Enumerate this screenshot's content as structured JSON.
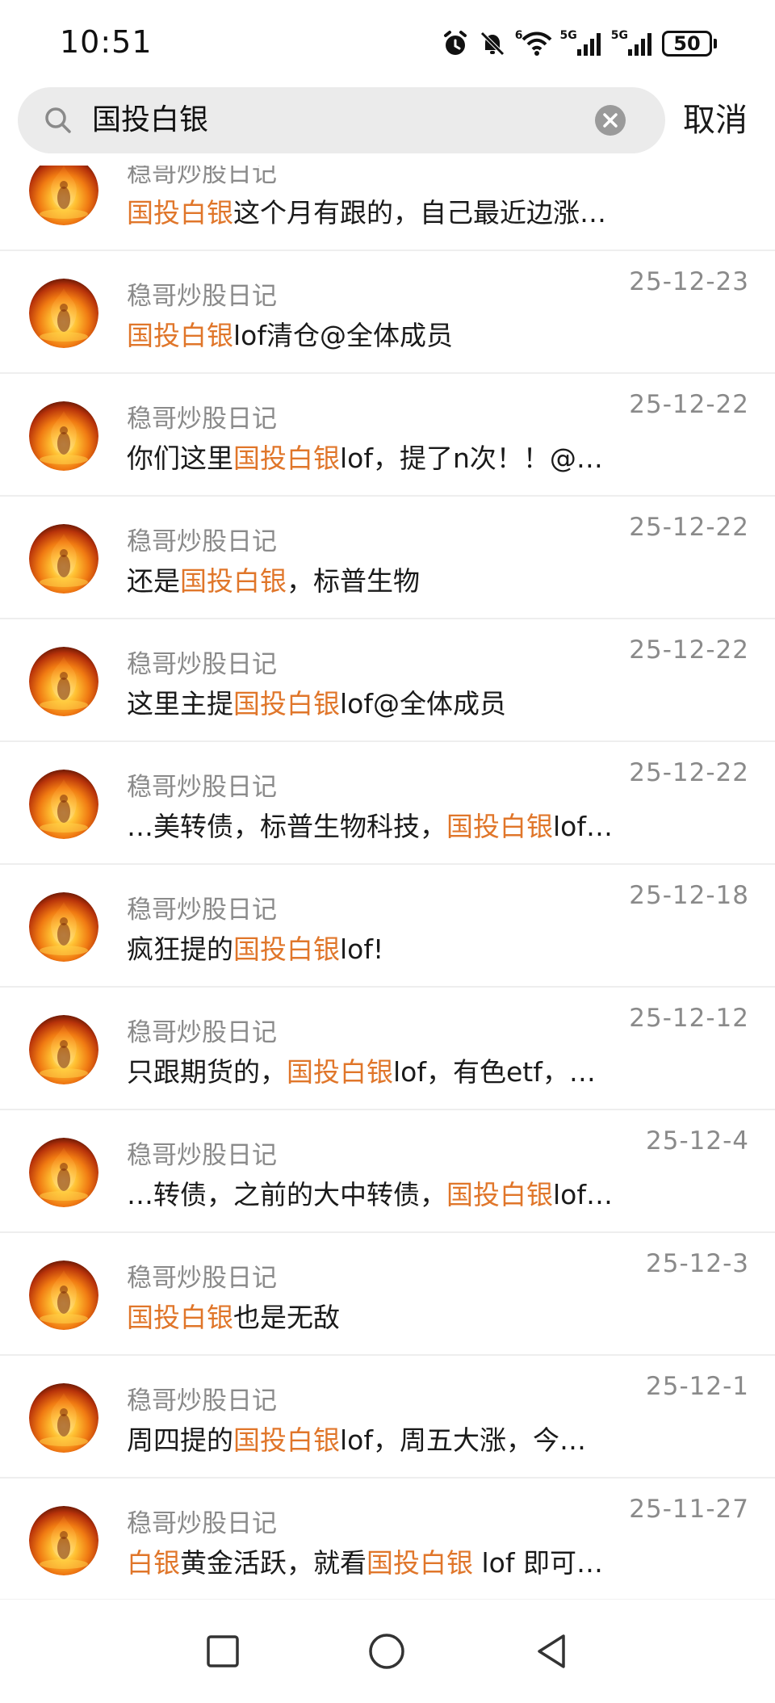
{
  "status_bar": {
    "time": "10:51",
    "signal_1_label": "5G",
    "signal_2_label": "5G",
    "wifi_label": "6",
    "battery": "50",
    "icons": [
      "alarm-icon",
      "mute-icon",
      "wifi-icon",
      "signal-icon",
      "signal-icon",
      "battery-icon"
    ]
  },
  "search": {
    "query": "国投白银",
    "cancel_label": "取消"
  },
  "colors": {
    "highlight": "#e0762a",
    "meta_text": "#8a8a8a",
    "search_bg": "#ebebeb"
  },
  "results": [
    {
      "name": "稳哥炒股日记",
      "date": "",
      "parts": [
        {
          "t": "国投白银",
          "h": true
        },
        {
          "t": "这个月有跟的，自己最近边涨…",
          "h": false
        }
      ]
    },
    {
      "name": "稳哥炒股日记",
      "date": "25-12-23",
      "parts": [
        {
          "t": "国投白银",
          "h": true
        },
        {
          "t": "lof清仓@全体成员",
          "h": false
        }
      ]
    },
    {
      "name": "稳哥炒股日记",
      "date": "25-12-22",
      "parts": [
        {
          "t": "你们这里",
          "h": false
        },
        {
          "t": "国投白银",
          "h": true
        },
        {
          "t": "lof，提了n次！！@…",
          "h": false
        }
      ]
    },
    {
      "name": "稳哥炒股日记",
      "date": "25-12-22",
      "parts": [
        {
          "t": "还是",
          "h": false
        },
        {
          "t": "国投白银",
          "h": true
        },
        {
          "t": "，标普生物",
          "h": false
        }
      ]
    },
    {
      "name": "稳哥炒股日记",
      "date": "25-12-22",
      "parts": [
        {
          "t": "这里主提",
          "h": false
        },
        {
          "t": "国投白银",
          "h": true
        },
        {
          "t": "lof@全体成员",
          "h": false
        }
      ]
    },
    {
      "name": "稳哥炒股日记",
      "date": "25-12-22",
      "parts": [
        {
          "t": "…美转债，标普生物科技，",
          "h": false
        },
        {
          "t": "国投白银",
          "h": true
        },
        {
          "t": "lof…",
          "h": false
        }
      ]
    },
    {
      "name": "稳哥炒股日记",
      "date": "25-12-18",
      "parts": [
        {
          "t": "疯狂提的",
          "h": false
        },
        {
          "t": "国投白银",
          "h": true
        },
        {
          "t": "lof!",
          "h": false
        }
      ]
    },
    {
      "name": "稳哥炒股日记",
      "date": "25-12-12",
      "parts": [
        {
          "t": "只跟期货的，",
          "h": false
        },
        {
          "t": "国投白银",
          "h": true
        },
        {
          "t": "lof，有色etf，…",
          "h": false
        }
      ]
    },
    {
      "name": "稳哥炒股日记",
      "date": "25-12-4",
      "parts": [
        {
          "t": "…转债，之前的大中转债，",
          "h": false
        },
        {
          "t": "国投白银",
          "h": true
        },
        {
          "t": "lof…",
          "h": false
        }
      ]
    },
    {
      "name": "稳哥炒股日记",
      "date": "25-12-3",
      "parts": [
        {
          "t": "国投白银",
          "h": true
        },
        {
          "t": "也是无敌",
          "h": false
        }
      ]
    },
    {
      "name": "稳哥炒股日记",
      "date": "25-12-1",
      "parts": [
        {
          "t": "周四提的",
          "h": false
        },
        {
          "t": "国投白银",
          "h": true
        },
        {
          "t": "lof，周五大涨，今…",
          "h": false
        }
      ]
    },
    {
      "name": "稳哥炒股日记",
      "date": "25-11-27",
      "parts": [
        {
          "t": "白银",
          "h": true
        },
        {
          "t": "黄金活跃，就看",
          "h": false
        },
        {
          "t": "国投白银",
          "h": true
        },
        {
          "t": " lof 即可…",
          "h": false
        }
      ]
    }
  ],
  "nav_bar": {
    "buttons": [
      "recents-square-icon",
      "home-circle-icon",
      "back-triangle-icon"
    ]
  }
}
